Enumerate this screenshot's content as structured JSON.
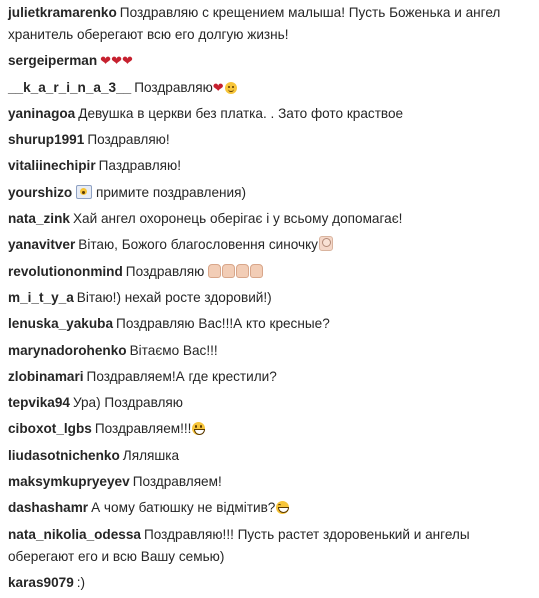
{
  "colors": {
    "text": "#262626",
    "heart": "#c6212f",
    "emoji_yellow": "#f7c53a",
    "background": "#ffffff"
  },
  "comments": [
    {
      "user": "julietkramarenko",
      "text": "Поздравляю с крещением малыша! Пусть Боженька и ангел хранитель оберегают всю его долгую жизнь!",
      "emoji": []
    },
    {
      "user": "sergeiperman",
      "text": "",
      "emoji": [
        "red-heart-icon",
        "red-heart-icon",
        "red-heart-icon"
      ]
    },
    {
      "user": "__k_a_r_i_n_a_3__",
      "text": "Поздравляю",
      "emoji": [
        "red-heart-icon",
        "smiling-face-icon"
      ]
    },
    {
      "user": "yaninagoa",
      "text": "Девушка в церкви без платка. . Зато фото краствое",
      "emoji": []
    },
    {
      "user": "shurup1991",
      "text": "Поздравляю!",
      "emoji": []
    },
    {
      "user": "vitaliinechipir",
      "text": "Паздравляю!",
      "emoji": []
    },
    {
      "user": "yourshizo",
      "text": "примите поздравления)",
      "emoji": [
        "screaming-face-icon"
      ]
    },
    {
      "user": "nata_zink",
      "text": "Хай ангел охоронець оберігає і у всьому допомагає!",
      "emoji": []
    },
    {
      "user": "yanavitver",
      "text": "Вітаю, Божого благословення синочку",
      "emoji": [
        "baby-icon"
      ]
    },
    {
      "user": "revolutiononmind",
      "text": "Поздравляю",
      "emoji": [
        "clapping-hands-icon",
        "clapping-hands-icon",
        "clapping-hands-icon",
        "clapping-hands-icon"
      ]
    },
    {
      "user": "m_i_t_y_a",
      "text": "Вітаю!) нехай росте здоровий!)",
      "emoji": []
    },
    {
      "user": "lenuska_yakuba",
      "text": "Поздравляю Вас!!!А кто кресные?",
      "emoji": []
    },
    {
      "user": "marynadorohenko",
      "text": "Вітаємо Вас!!!",
      "emoji": []
    },
    {
      "user": "zlobinamari",
      "text": "Поздравляем!А где крестили?",
      "emoji": []
    },
    {
      "user": "tepvika94",
      "text": "Ура) Поздравляю",
      "emoji": []
    },
    {
      "user": "ciboxot_lgbs",
      "text": "Поздравляем!!!",
      "emoji": [
        "grinning-face-icon"
      ]
    },
    {
      "user": "liudasotnichenko",
      "text": "Ляляшка",
      "emoji": []
    },
    {
      "user": "maksymkupryeyev",
      "text": "Поздравляем!",
      "emoji": []
    },
    {
      "user": "dashashamr",
      "text": "А чому батюшку не відмітив?",
      "emoji": [
        "laughing-face-icon"
      ]
    },
    {
      "user": "nata_nikolia_odessa",
      "text": "Поздравляю!!! Пусть растет здоровенький и ангелы оберегают его и всю Вашу семью)",
      "emoji": []
    },
    {
      "user": "karas9079",
      "text": ":)",
      "emoji": []
    }
  ]
}
